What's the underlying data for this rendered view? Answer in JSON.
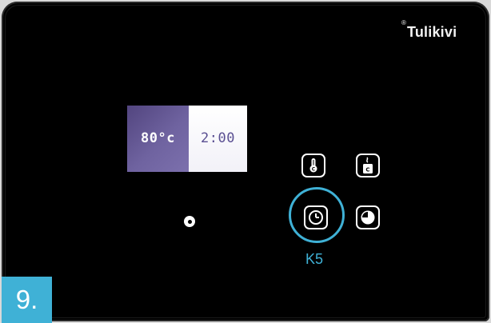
{
  "brand": {
    "name": "Tulikivi",
    "mark": "®"
  },
  "display": {
    "temperature": "80°c",
    "time": "2:00"
  },
  "keys": [
    {
      "id": "k1",
      "icon": "thermometer-celsius-icon"
    },
    {
      "id": "k2",
      "icon": "steam-celsius-icon"
    },
    {
      "id": "k5",
      "icon": "clock-icon",
      "label": "K5",
      "highlighted": true
    },
    {
      "id": "k6",
      "icon": "timer-icon"
    }
  ],
  "step": {
    "label": "9."
  },
  "colors": {
    "highlight": "#3fb1d6",
    "display_temp_bg": "#6f63a0",
    "display_time_fg": "#5a4f92"
  }
}
